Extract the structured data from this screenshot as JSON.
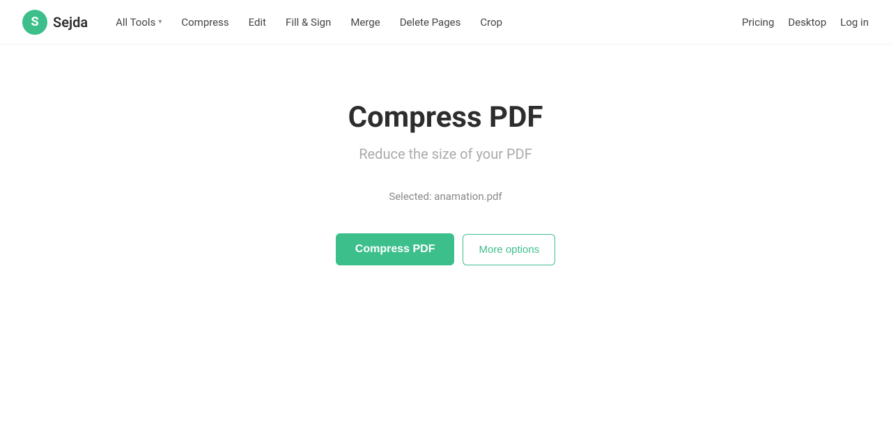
{
  "logo": {
    "icon_letter": "S",
    "text": "Sejda"
  },
  "nav": {
    "items": [
      {
        "label": "All Tools",
        "has_chevron": true
      },
      {
        "label": "Compress",
        "has_chevron": false
      },
      {
        "label": "Edit",
        "has_chevron": false
      },
      {
        "label": "Fill & Sign",
        "has_chevron": false
      },
      {
        "label": "Merge",
        "has_chevron": false
      },
      {
        "label": "Delete Pages",
        "has_chevron": false
      },
      {
        "label": "Crop",
        "has_chevron": false
      }
    ]
  },
  "header_right": {
    "links": [
      {
        "label": "Pricing"
      },
      {
        "label": "Desktop"
      },
      {
        "label": "Log in"
      }
    ]
  },
  "main": {
    "title": "Compress PDF",
    "subtitle": "Reduce the size of your PDF",
    "selected_label": "Selected: anamation.pdf",
    "compress_button": "Compress PDF",
    "more_options_button": "More options"
  }
}
